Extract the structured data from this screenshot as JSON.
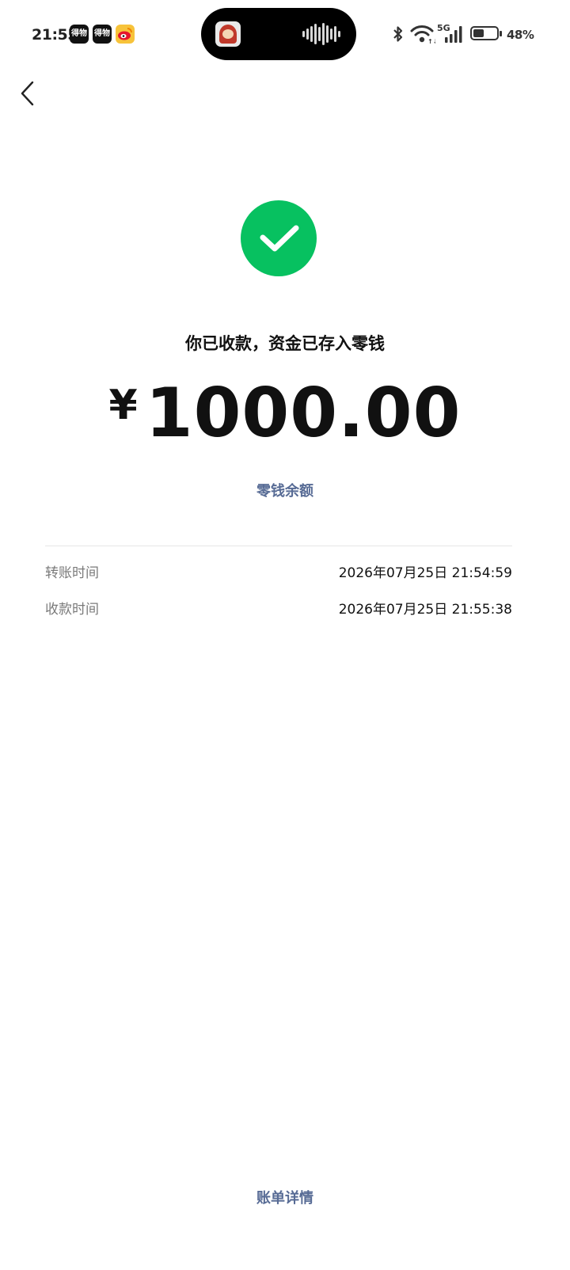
{
  "status_bar": {
    "time": "21:55",
    "notification_apps": [
      {
        "icon": "dewu-app-icon",
        "label": "得物"
      },
      {
        "icon": "dewu-app-icon",
        "label": "得物"
      },
      {
        "icon": "weibo-app-icon",
        "label": ""
      }
    ],
    "network": "5G",
    "battery_percent": "48%",
    "battery_level": 0.48
  },
  "colors": {
    "success_green": "#07c160",
    "link_blue": "#576b95",
    "text_primary": "#111111",
    "text_secondary": "#7a7a7a"
  },
  "header": {
    "back_icon": "chevron-left-icon"
  },
  "result": {
    "icon": "check-circle-icon",
    "title": "你已收款，资金已存入零钱",
    "currency_symbol": "¥",
    "amount": "1000.00",
    "balance_link": "零钱余额"
  },
  "details": [
    {
      "label": "转账时间",
      "value": "2026年07月25日  21:54:59"
    },
    {
      "label": "收款时间",
      "value": "2026年07月25日  21:55:38"
    }
  ],
  "footer": {
    "bill_details_link": "账单详情"
  }
}
